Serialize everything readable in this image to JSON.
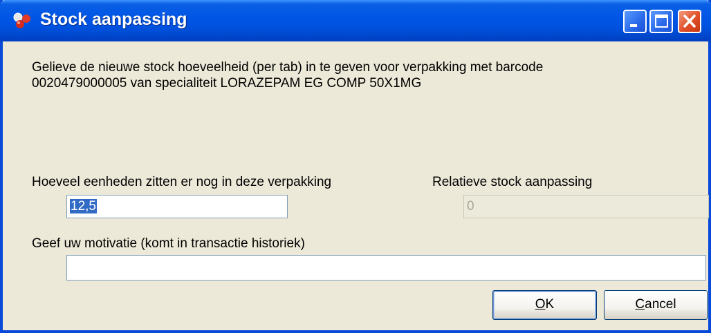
{
  "window": {
    "title": "Stock aanpassing",
    "buttons": {
      "minimize": "minimize-icon",
      "maximize": "maximize-icon",
      "close": "close-icon"
    }
  },
  "message": {
    "line1": "Gelieve de nieuwe stock hoeveelheid (per tab) in te geven voor verpakking met barcode",
    "line2": "0020479000005 van specialiteit LORAZEPAM EG COMP 50X1MG"
  },
  "units": {
    "label": "Hoeveel eenheden zitten er nog in deze verpakking",
    "value": "12,5"
  },
  "relative": {
    "label": "Relatieve stock aanpassing",
    "value": "0"
  },
  "motivation": {
    "label": "Geef uw motivatie (komt in transactie historiek)",
    "value": ""
  },
  "actions": {
    "ok_accel": "O",
    "ok_rest": "K",
    "cancel_accel": "C",
    "cancel_rest": "ancel"
  },
  "colors": {
    "titlebar": "#0055e5",
    "window_bg": "#ece9d8",
    "selection": "#316ac5",
    "close_button": "#e0502a"
  }
}
